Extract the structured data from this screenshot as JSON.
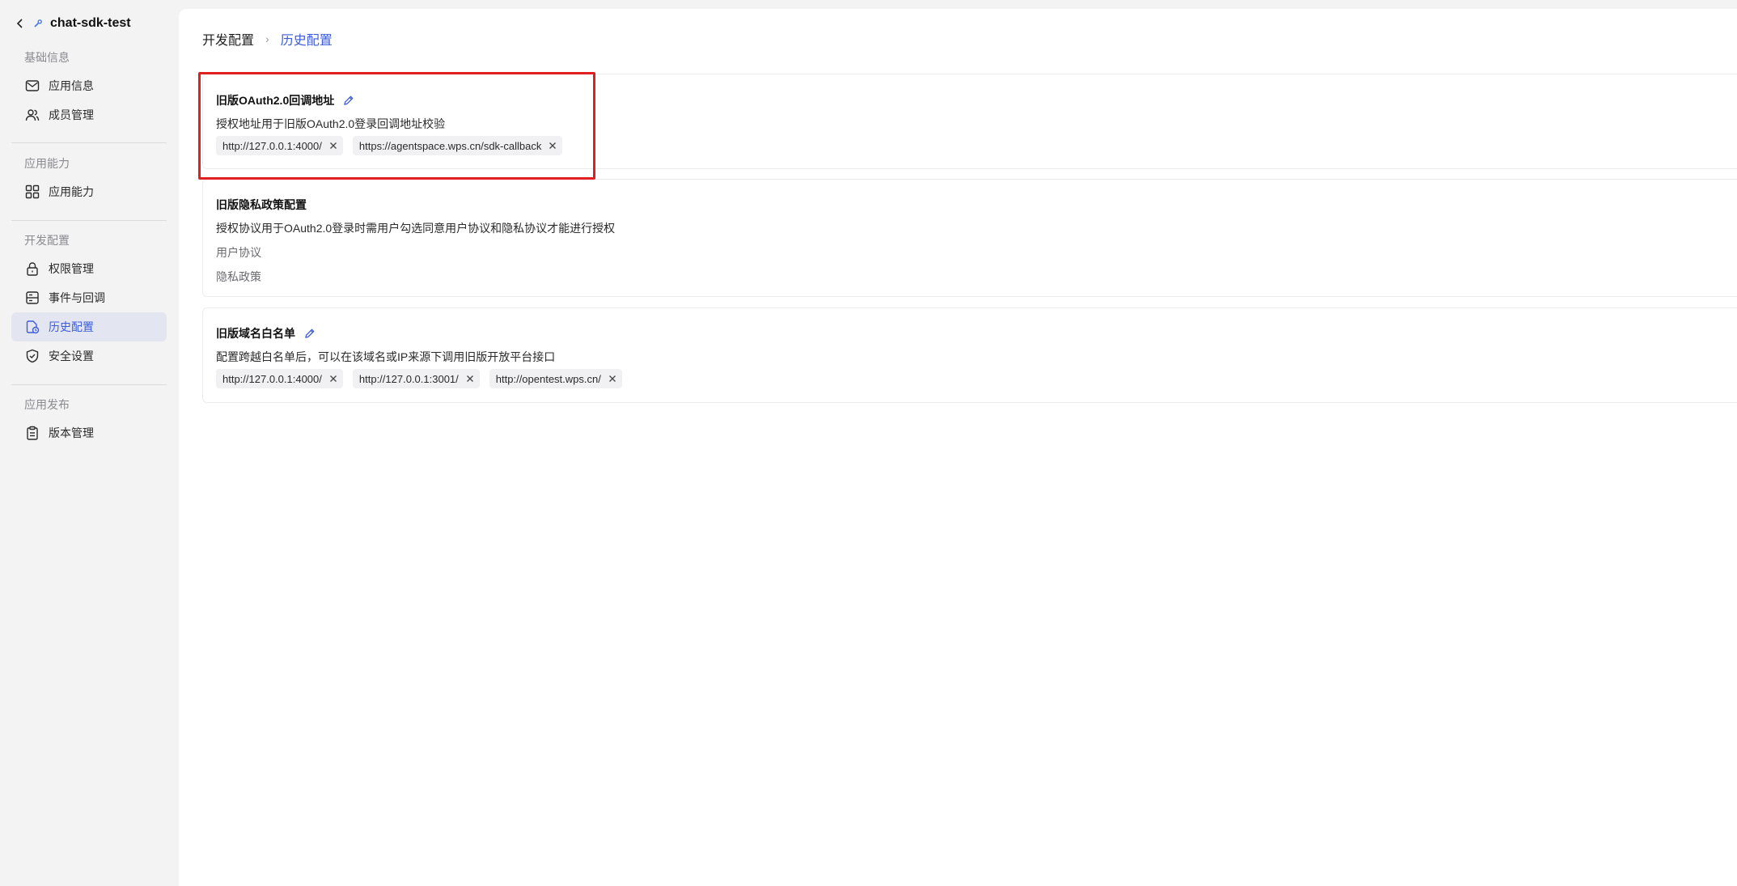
{
  "app": {
    "name": "chat-sdk-test"
  },
  "sidebar": {
    "groups": [
      {
        "title": "基础信息",
        "items": [
          {
            "label": "应用信息",
            "icon": "envelope-icon"
          },
          {
            "label": "成员管理",
            "icon": "users-icon"
          }
        ]
      },
      {
        "title": "应用能力",
        "items": [
          {
            "label": "应用能力",
            "icon": "grid-icon"
          }
        ]
      },
      {
        "title": "开发配置",
        "items": [
          {
            "label": "权限管理",
            "icon": "lock-icon"
          },
          {
            "label": "事件与回调",
            "icon": "event-icon"
          },
          {
            "label": "历史配置",
            "icon": "history-file-icon",
            "active": true
          },
          {
            "label": "安全设置",
            "icon": "shield-icon"
          }
        ]
      },
      {
        "title": "应用发布",
        "items": [
          {
            "label": "版本管理",
            "icon": "clipboard-icon"
          }
        ]
      }
    ]
  },
  "breadcrumb": {
    "root": "开发配置",
    "separator": "›",
    "current": "历史配置"
  },
  "cards": {
    "oauth": {
      "title": "旧版OAuth2.0回调地址",
      "description": "授权地址用于旧版OAuth2.0登录回调地址校验",
      "tags": [
        "http://127.0.0.1:4000/",
        "https://agentspace.wps.cn/sdk-callback"
      ]
    },
    "privacy": {
      "title": "旧版隐私政策配置",
      "description": "授权协议用于OAuth2.0登录时需用户勾选同意用户协议和隐私协议才能进行授权",
      "links": [
        "用户协议",
        "隐私政策"
      ]
    },
    "whitelist": {
      "title": "旧版域名白名单",
      "description": "配置跨越白名单后，可以在该域名或IP来源下调用旧版开放平台接口",
      "tags": [
        "http://127.0.0.1:4000/",
        "http://127.0.0.1:3001/",
        "http://opentest.wps.cn/"
      ]
    }
  },
  "colors": {
    "accent": "#3d5cd6",
    "highlight": "#e02020",
    "active_bg": "#e3e6f1"
  }
}
